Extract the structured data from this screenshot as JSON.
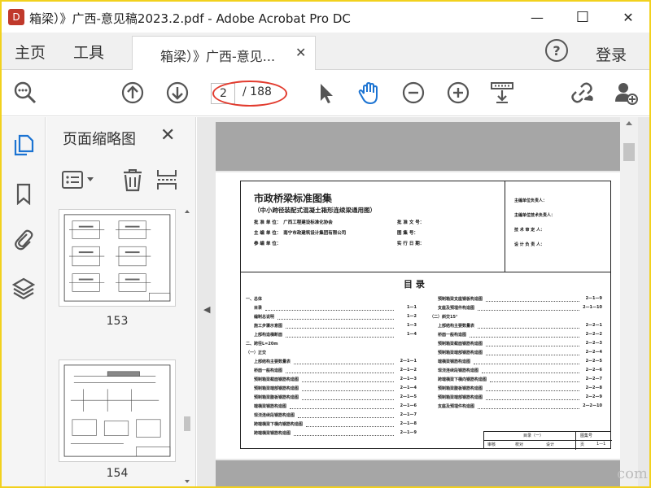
{
  "window": {
    "icon_text": "D",
    "title": "箱梁）》广西-意见稿2023.2.pdf - Adobe Acrobat Pro DC",
    "minimize": "—",
    "maximize": "☐",
    "close": "✕"
  },
  "tabs": {
    "home": "主页",
    "tools": "工具",
    "document": "箱梁）》广西-意见...",
    "close": "✕",
    "help": "?",
    "login": "登录"
  },
  "toolbar": {
    "current_page": "2",
    "total_pages": "/ 188"
  },
  "thumbnails": {
    "title": "页面缩略图",
    "close": "✕",
    "pages": [
      "153",
      "154"
    ]
  },
  "document": {
    "title": "市政桥梁标准图集",
    "subtitle": "（中小跨径装配式混凝土箱形连续梁通用图）",
    "meta_left": [
      {
        "label": "批 准 单 位：",
        "value": "广西工程建设标准化协会"
      },
      {
        "label": "主 编 单 位：",
        "value": "南宁市政建筑设计集团有限公司"
      },
      {
        "label": "参 编 单 位：",
        "value": ""
      }
    ],
    "meta_mid": [
      {
        "label": "批 准 文 号：",
        "value": ""
      },
      {
        "label": "图 集 号：",
        "value": ""
      },
      {
        "label": "实 行 日 期：",
        "value": ""
      }
    ],
    "meta_right": [
      "主编单位负责人：",
      "主编单位技术负责人：",
      "技 术 审 定 人：",
      "设 计 负 责 人："
    ],
    "toc_title": "目    录",
    "toc_left": [
      {
        "label": "一、总体",
        "page": ""
      },
      {
        "label": "目录",
        "page": "1—1"
      },
      {
        "label": "编制总说明",
        "page": "1—2"
      },
      {
        "label": "施工步骤示意图",
        "page": "1—3"
      },
      {
        "label": "上部构造横断面",
        "page": "1—4"
      },
      {
        "label": "二、跨径L=20m",
        "page": ""
      },
      {
        "label": "（一）正交",
        "page": ""
      },
      {
        "label": "上部结构主要数量表",
        "page": "2—1—1"
      },
      {
        "label": "桥面一般构造图",
        "page": "2—1—2"
      },
      {
        "label": "预制箱梁截面钢筋构造图",
        "page": "2—1—3"
      },
      {
        "label": "预制箱梁端部钢筋构造图",
        "page": "2—1—4"
      },
      {
        "label": "预制箱梁腹板钢筋构造图",
        "page": "2—1—5"
      },
      {
        "label": "端横梁钢筋构造图",
        "page": "2—1—6"
      },
      {
        "label": "现浇连续段钢筋构造图",
        "page": "2—1—7"
      },
      {
        "label": "跨端横梁下横向钢筋构造图",
        "page": "2—1—8"
      },
      {
        "label": "跨端横梁钢筋构造图",
        "page": "2—1—9"
      }
    ],
    "toc_right": [
      {
        "label": "预制箱梁支座钢板构造图",
        "page": "2—1—9"
      },
      {
        "label": "支座及预埋件构造图",
        "page": "2—1—10"
      },
      {
        "label": "（二）斜交15°",
        "page": ""
      },
      {
        "label": "上部结构主要数量表",
        "page": "2—2—1"
      },
      {
        "label": "桥面一般构造图",
        "page": "2—2—2"
      },
      {
        "label": "预制箱梁截面钢筋构造图",
        "page": "2—2—3"
      },
      {
        "label": "预制箱梁端部钢筋构造图",
        "page": "2—2—4"
      },
      {
        "label": "端横梁钢筋构造图",
        "page": "2—2—5"
      },
      {
        "label": "现浇连续段钢筋构造图",
        "page": "2—2—6"
      },
      {
        "label": "跨端横梁下横向钢筋构造图",
        "page": "2—2—7"
      },
      {
        "label": "预制箱梁腹板钢筋构造图",
        "page": "2—2—8"
      },
      {
        "label": "预制箱梁端部钢筋构造图",
        "page": "2—2—9"
      },
      {
        "label": "支座及预埋件构造图",
        "page": "2—2—10"
      }
    ],
    "titleblock_name": "目录（一）",
    "titleblock_no": "图集号",
    "titleblock_page": "1—1",
    "titleblock_cells": [
      "审核",
      "校对",
      "设计",
      "页"
    ]
  },
  "watermark": "com"
}
